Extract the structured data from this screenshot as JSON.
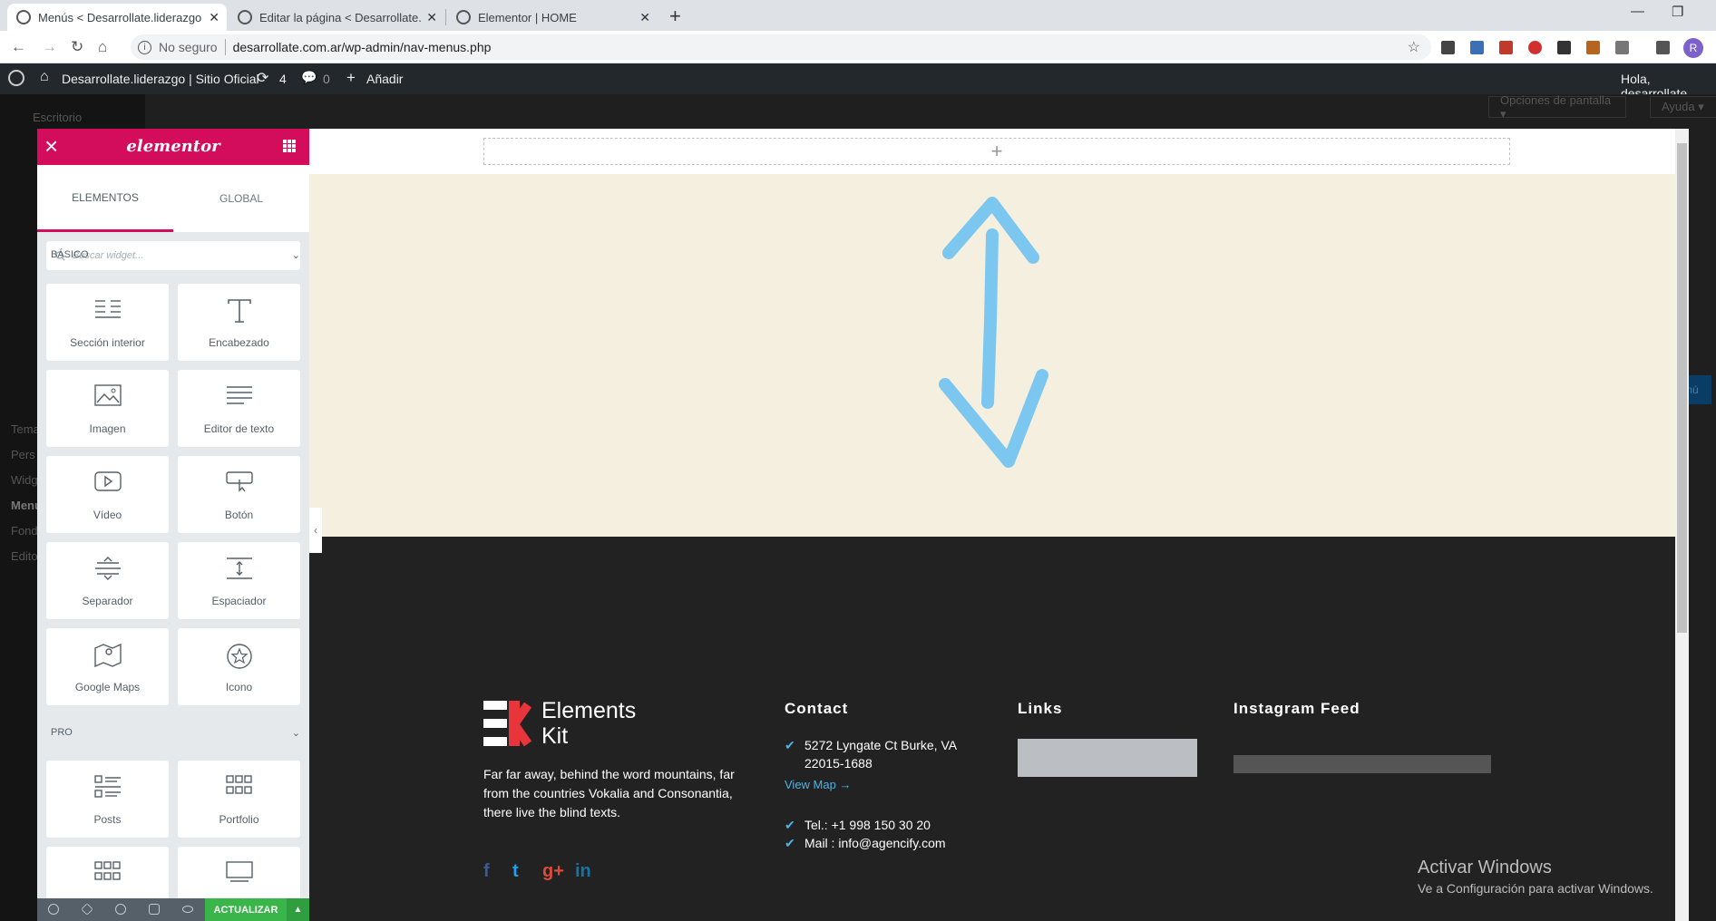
{
  "browser": {
    "tabs": [
      {
        "title": "Menús < Desarrollate.liderazgo |",
        "active": true
      },
      {
        "title": "Editar la página < Desarrollate.li",
        "active": false
      },
      {
        "title": "Elementor | HOME",
        "active": false
      }
    ],
    "new_tab": "+",
    "security": "No seguro",
    "url": "desarrollate.com.ar/wp-admin/nav-menus.php",
    "profile_initial": "R"
  },
  "adminbar": {
    "site_name": "Desarrollate.liderazgo | Sitio Oficial",
    "updates_count": "4",
    "comments_count": "0",
    "add_label": "Añadir",
    "greeting": "Hola, desarrollate"
  },
  "wp": {
    "dashboard": "Escritorio",
    "screen_options": "Opciones de pantalla ▾",
    "help": "Ayuda ▾",
    "menu_items": [
      "Tema",
      "Pers",
      "Widg",
      "Menú",
      "Fond",
      "Edito"
    ],
    "save_btn": "nú"
  },
  "elementor": {
    "brand": "elementor",
    "tab_elements": "ELEMENTOS",
    "tab_global": "GLOBAL",
    "search_placeholder": "Buscar widget...",
    "category_basic": "BÁSICO",
    "category_pro": "PRO",
    "widgets": [
      {
        "label": "Sección interior",
        "icon": "inner-section-icon"
      },
      {
        "label": "Encabezado",
        "icon": "heading-icon"
      },
      {
        "label": "Imagen",
        "icon": "image-icon"
      },
      {
        "label": "Editor de texto",
        "icon": "text-editor-icon"
      },
      {
        "label": "Vídeo",
        "icon": "video-icon"
      },
      {
        "label": "Botón",
        "icon": "button-icon"
      },
      {
        "label": "Separador",
        "icon": "divider-icon"
      },
      {
        "label": "Espaciador",
        "icon": "spacer-icon"
      },
      {
        "label": "Google Maps",
        "icon": "map-icon"
      },
      {
        "label": "Icono",
        "icon": "star-icon"
      }
    ],
    "pro_widgets": [
      {
        "label": "Posts",
        "icon": "posts-icon"
      },
      {
        "label": "Portfolio",
        "icon": "portfolio-icon"
      }
    ],
    "update_button": "ACTUALIZAR"
  },
  "footer": {
    "logo_line1": "Elements",
    "logo_line2": "Kit",
    "about": "Far far away, behind the word mountains, far from the countries Vokalia and Consonantia, there live the blind texts.",
    "social": [
      "f",
      "t",
      "g+",
      "in"
    ],
    "contact_heading": "Contact",
    "address": "5272 Lyngate Ct Burke, VA 22015-1688",
    "view_map": "View Map",
    "phone": "Tel.: +1 998 150 30 20",
    "mail": "Mail : info@agencify.com",
    "links_heading": "Links",
    "instagram_heading": "Instagram Feed"
  },
  "windows": {
    "line1": "Activar Windows",
    "line2": "Ve a Configuración para activar Windows."
  },
  "colors": {
    "elementor_accent": "#d30c5c",
    "update_green": "#39b54a",
    "arrow_blue": "#7cc7f0",
    "link_blue": "#4fb3e8"
  }
}
